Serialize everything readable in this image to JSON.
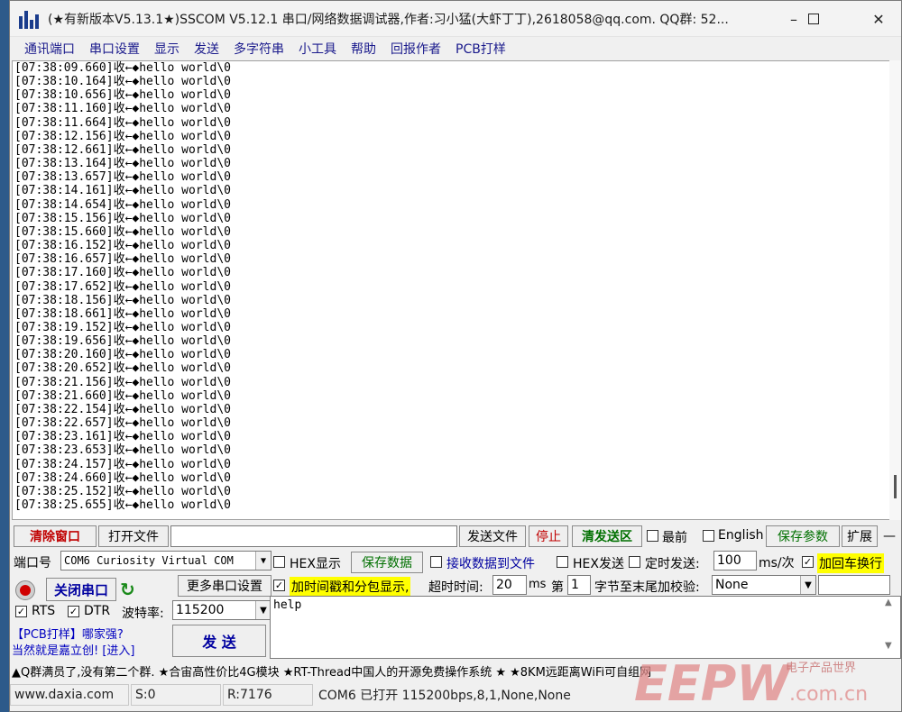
{
  "window": {
    "title": "(★有新版本V5.13.1★)SSCOM V5.12.1 串口/网络数据调试器,作者:习小猛(大虾丁丁),2618058@qq.com. QQ群: 52...",
    "minimize_icon": "minimize-icon",
    "maximize_icon": "maximize-icon",
    "close_icon": "close-icon"
  },
  "menu": [
    "通讯端口",
    "串口设置",
    "显示",
    "发送",
    "多字符串",
    "小工具",
    "帮助",
    "回报作者",
    "PCB打样"
  ],
  "log_lines": [
    "[07:38:09.660]收←◆hello world\\0",
    "[07:38:10.164]收←◆hello world\\0",
    "[07:38:10.656]收←◆hello world\\0",
    "[07:38:11.160]收←◆hello world\\0",
    "[07:38:11.664]收←◆hello world\\0",
    "[07:38:12.156]收←◆hello world\\0",
    "[07:38:12.661]收←◆hello world\\0",
    "[07:38:13.164]收←◆hello world\\0",
    "[07:38:13.657]收←◆hello world\\0",
    "[07:38:14.161]收←◆hello world\\0",
    "[07:38:14.654]收←◆hello world\\0",
    "[07:38:15.156]收←◆hello world\\0",
    "[07:38:15.660]收←◆hello world\\0",
    "[07:38:16.152]收←◆hello world\\0",
    "[07:38:16.657]收←◆hello world\\0",
    "[07:38:17.160]收←◆hello world\\0",
    "[07:38:17.652]收←◆hello world\\0",
    "[07:38:18.156]收←◆hello world\\0",
    "[07:38:18.661]收←◆hello world\\0",
    "[07:38:19.152]收←◆hello world\\0",
    "[07:38:19.656]收←◆hello world\\0",
    "[07:38:20.160]收←◆hello world\\0",
    "[07:38:20.652]收←◆hello world\\0",
    "[07:38:21.156]收←◆hello world\\0",
    "[07:38:21.660]收←◆hello world\\0",
    "[07:38:22.154]收←◆hello world\\0",
    "[07:38:22.657]收←◆hello world\\0",
    "[07:38:23.161]收←◆hello world\\0",
    "[07:38:23.653]收←◆hello world\\0",
    "[07:38:24.157]收←◆hello world\\0",
    "[07:38:24.660]收←◆hello world\\0",
    "[07:38:25.152]收←◆hello world\\0",
    "[07:38:25.655]收←◆hello world\\0"
  ],
  "toolbar": {
    "clear_window": "清除窗口",
    "open_file": "打开文件",
    "file_path": "",
    "send_file": "发送文件",
    "stop": "停止",
    "clear_send": "清发送区",
    "topmost": "最前",
    "english": "English",
    "save_params": "保存参数",
    "expand": "扩展",
    "collapse": "—"
  },
  "port": {
    "label": "端口号",
    "selected": "COM6 Curiosity Virtual COM",
    "close_port": "关闭串口",
    "more_settings": "更多串口设置",
    "rts": "RTS",
    "dtr": "DTR",
    "baud_label": "波特率:",
    "baud_value": "115200"
  },
  "display": {
    "hex_display": "HEX显示",
    "save_data": "保存数据",
    "recv_to_file": "接收数据到文件",
    "timestamp": "加时间戳和分包显示,",
    "timeout_label": "超时时间:",
    "timeout_value": "20",
    "timeout_unit": "ms"
  },
  "send": {
    "hex_send": "HEX发送",
    "timed_send": "定时发送:",
    "interval": "100",
    "interval_unit": "ms/次",
    "add_crlf": "加回车换行",
    "nth_label": "第",
    "nth_value": "1",
    "checksum_label": "字节至末尾加校验:",
    "checksum_value": "None",
    "send_text": "help",
    "send_button": "发 送"
  },
  "promo": {
    "line1": "【PCB打样】哪家强?",
    "line2": "当然就是嘉立创! [进入]"
  },
  "ticker": "▲Q群满员了,没有第二个群. ★合宙高性价比4G模块 ★RT-Thread中国人的开源免费操作系统 ★ ★8KM远距离WiFi可自组网",
  "status": {
    "website": "www.daxia.com",
    "sent": "S:0",
    "received": "R:7176",
    "port_state": "COM6 已打开  115200bps,8,1,None,None"
  },
  "watermark": {
    "brand": "EEPW",
    "cn": "电子产品世界",
    "domain": ".com.cn"
  },
  "colors": {
    "highlight_yellow": "#ffff00",
    "red_text": "#c00000",
    "green_text": "#007000",
    "blue_text": "#0000a0"
  }
}
